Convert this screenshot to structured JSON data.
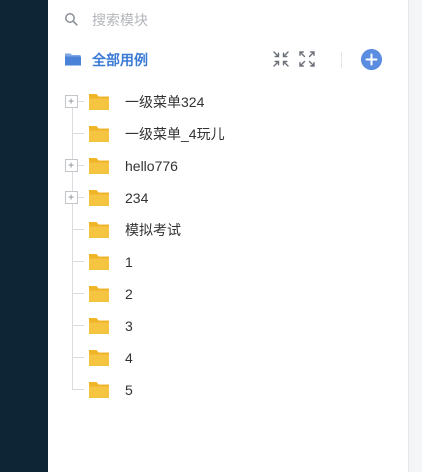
{
  "search": {
    "placeholder": "搜索模块",
    "icon": "search-icon"
  },
  "header": {
    "title": "全部用例",
    "icon": "folder-stack-icon",
    "actions": {
      "collapse_icon": "collapse-all-icon",
      "expand_icon": "expand-all-icon",
      "add_icon": "plus-circle-icon"
    }
  },
  "tree": {
    "nodes": [
      {
        "label": "一级菜单324",
        "expandable": true
      },
      {
        "label": "一级菜单_4玩儿",
        "expandable": false
      },
      {
        "label": "hello776",
        "expandable": true
      },
      {
        "label": "234",
        "expandable": true
      },
      {
        "label": "模拟考试",
        "expandable": false
      },
      {
        "label": "1",
        "expandable": false
      },
      {
        "label": "2",
        "expandable": false
      },
      {
        "label": "3",
        "expandable": false
      },
      {
        "label": "4",
        "expandable": false
      },
      {
        "label": "5",
        "expandable": false
      }
    ]
  },
  "colors": {
    "accent": "#3a7bd5",
    "add_button": "#5a8de0",
    "folder": "#f5c542",
    "sidebar_dark": "#0e2535"
  }
}
